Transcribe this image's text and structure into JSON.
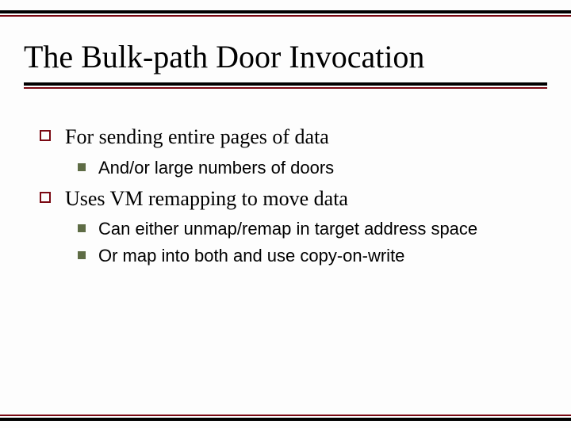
{
  "title": "The Bulk-path Door Invocation",
  "items": [
    {
      "text": "For sending entire pages of data",
      "sub": [
        {
          "text": "And/or large numbers of doors"
        }
      ]
    },
    {
      "text": "Uses VM remapping to move data",
      "sub": [
        {
          "text": "Can either unmap/remap in target address space"
        },
        {
          "text": "Or map into both and use copy-on-write"
        }
      ]
    }
  ]
}
